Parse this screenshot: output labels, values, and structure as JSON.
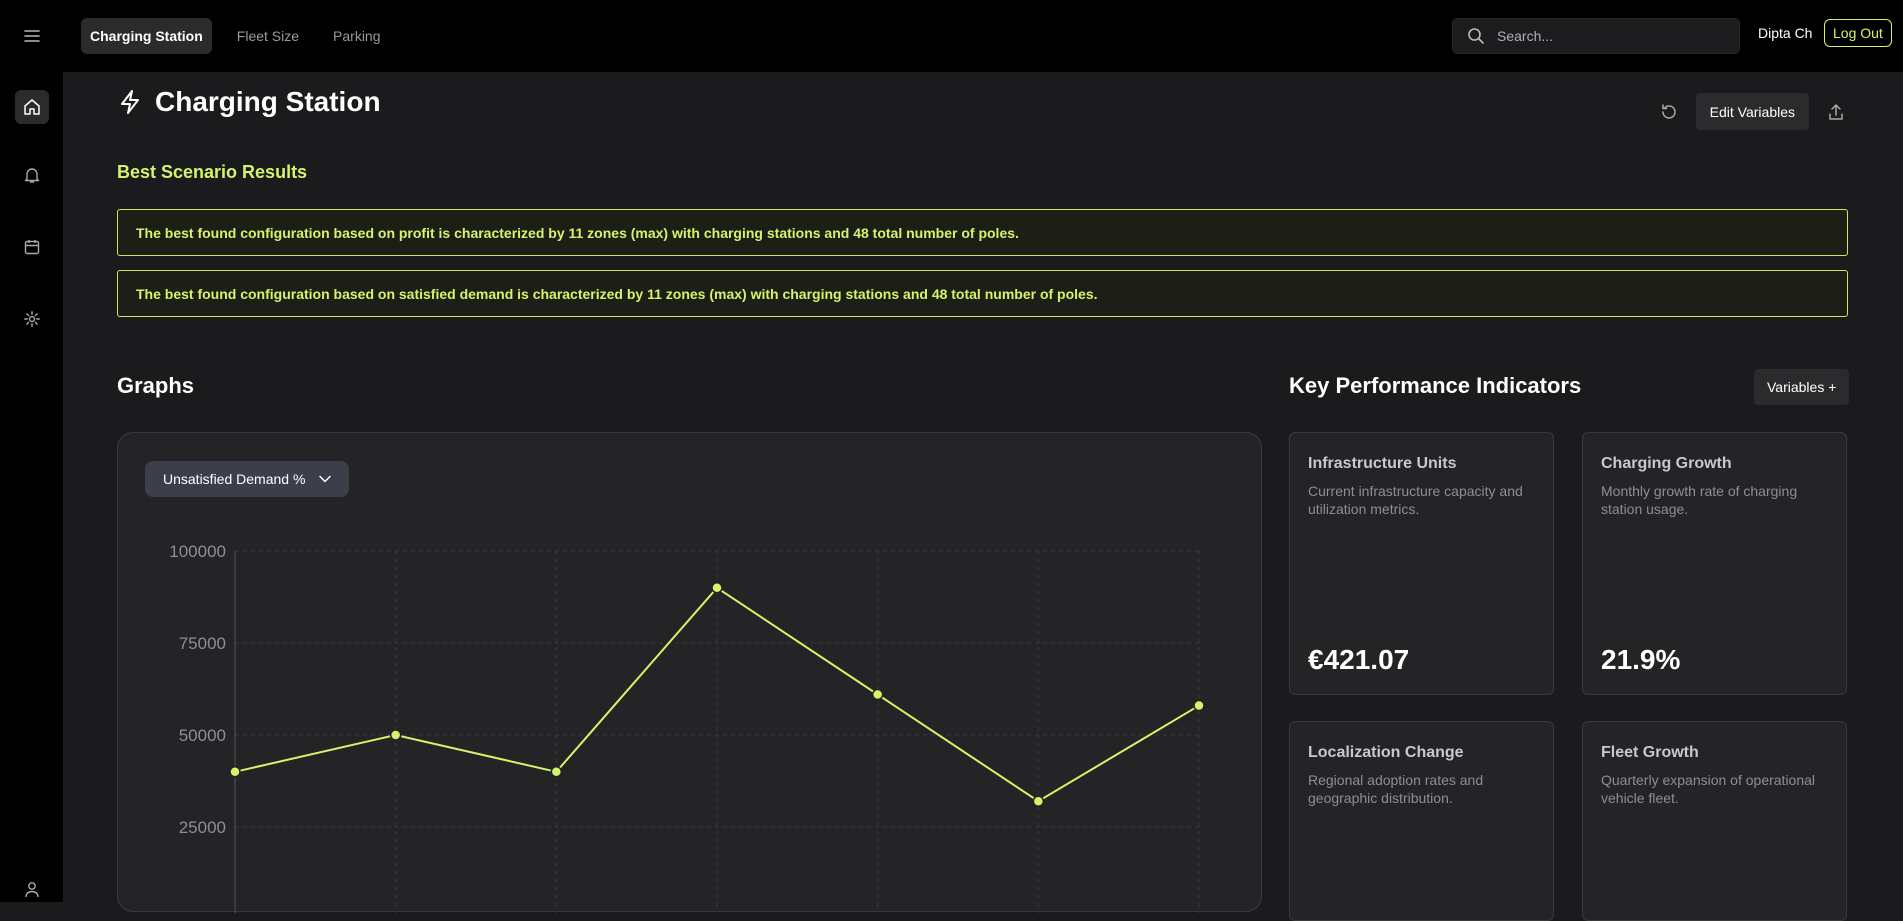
{
  "nav": {
    "tabs": [
      {
        "label": "Charging Station"
      },
      {
        "label": "Fleet Size"
      },
      {
        "label": "Parking"
      }
    ],
    "search_placeholder": "Search...",
    "user_name": "Dipta Ch",
    "logout_label": "Log Out"
  },
  "page": {
    "title": "Charging Station",
    "edit_label": "Edit Variables"
  },
  "results": {
    "title": "Best Scenario Results",
    "items": [
      "The best found configuration based on profit is characterized by 11 zones (max) with charging stations and 48 total number of poles.",
      "The best found configuration based on satisfied demand is characterized by 11 zones (max) with charging stations and 48 total number of poles."
    ]
  },
  "graphs": {
    "title": "Graphs",
    "selected_metric": "Unsatisfied Demand %"
  },
  "chart_data": {
    "type": "line",
    "x": [
      0,
      1,
      2,
      3,
      4,
      5,
      6
    ],
    "values": [
      40000,
      50000,
      40000,
      90000,
      61000,
      32000,
      58000
    ],
    "yticks": [
      100000,
      75000,
      50000,
      25000
    ],
    "ylim": [
      0,
      100000
    ],
    "grid": true,
    "line_color": "#d4f46a"
  },
  "kpi": {
    "title": "Key Performance Indicators",
    "variables_label": "Variables +",
    "cards": [
      {
        "title": "Infrastructure Units",
        "desc": "Current infrastructure capacity and utilization metrics.",
        "value": "€421.07"
      },
      {
        "title": "Charging Growth",
        "desc": "Monthly growth rate of charging station usage.",
        "value": "21.9%"
      },
      {
        "title": "Localization Change",
        "desc": "Regional adoption rates and geographic distribution.",
        "value": ""
      },
      {
        "title": "Fleet Growth",
        "desc": "Quarterly expansion of operational vehicle fleet.",
        "value": ""
      }
    ]
  },
  "colors": {
    "accent": "#d4f46a",
    "background": "#1b1b1d",
    "topbar": "#000000"
  }
}
